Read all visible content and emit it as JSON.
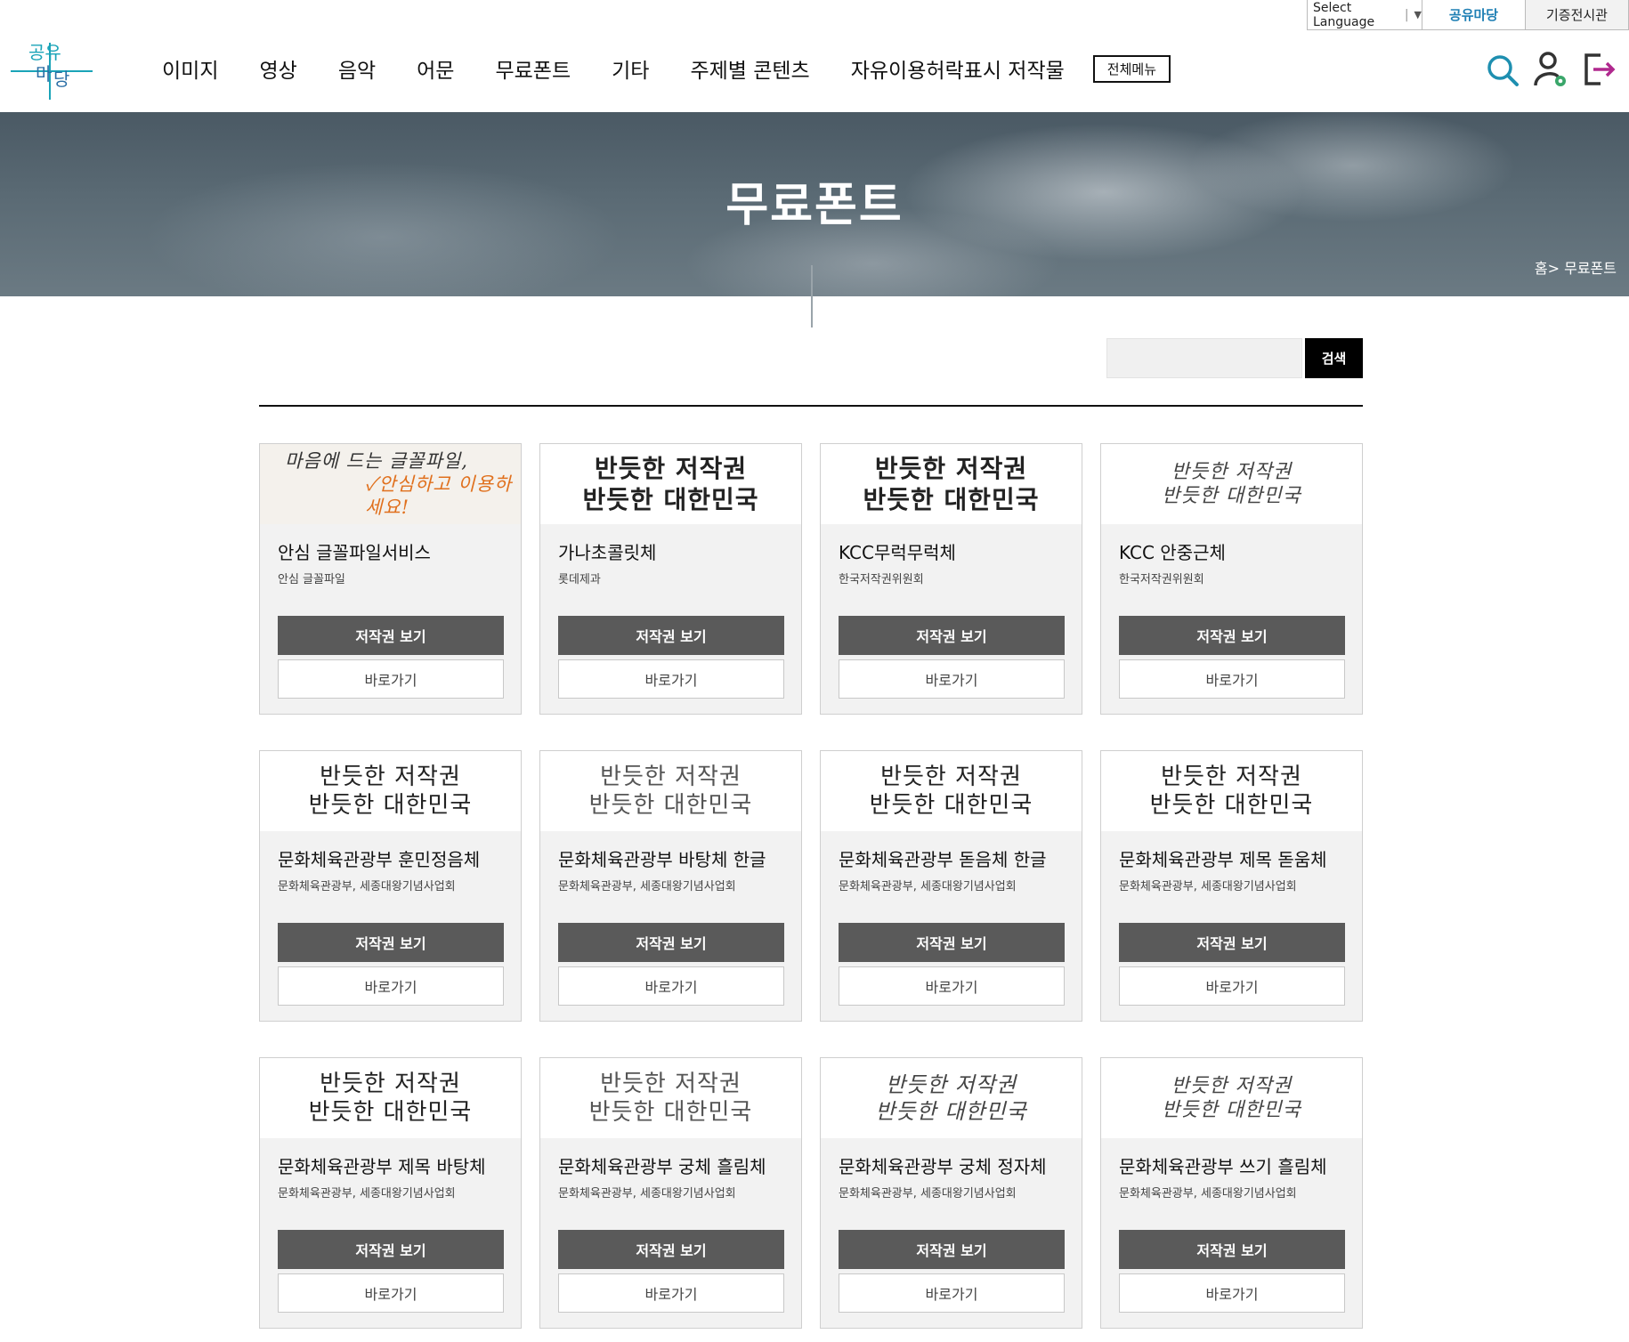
{
  "utility": {
    "language": "Select Language",
    "share_madang": "공유마당",
    "donation_hall": "기증전시관"
  },
  "header": {
    "logo_text": "공유마당",
    "nav": [
      "이미지",
      "영상",
      "음악",
      "어문",
      "무료폰트",
      "기타",
      "주제별 콘텐츠",
      "자유이용허락표시 저작물"
    ],
    "all_menu": "전체메뉴",
    "icons": [
      "search-icon",
      "user-settings-icon",
      "logout-icon"
    ]
  },
  "banner": {
    "title": "무료폰트",
    "breadcrumb": "홈> 무료폰트"
  },
  "search": {
    "placeholder": "",
    "button": "검색"
  },
  "buttons": {
    "copyright": "저작권 보기",
    "go": "바로가기"
  },
  "colors": {
    "accent_blue": "#1e7fb4",
    "button_dark": "#5a5a5a",
    "logo_teal": "#1aa4b8"
  },
  "cards": [
    {
      "preview_lines": [
        "마음에 드는 글꼴파일,",
        "✓안심하고 이용하세요!"
      ],
      "style": "first",
      "title": "안심 글꼴파일서비스",
      "provider": "안심 글꼴파일"
    },
    {
      "preview_lines": [
        "반듯한 저작권",
        "반듯한 대한민국"
      ],
      "style": "bold",
      "title": "가나초콜릿체",
      "provider": "롯데제과"
    },
    {
      "preview_lines": [
        "반듯한 저작권",
        "반듯한 대한민국"
      ],
      "style": "brush",
      "title": "KCC무럭무럭체",
      "provider": "한국저작권위원회"
    },
    {
      "preview_lines": [
        "반듯한 저작권",
        "반듯한 대한민국"
      ],
      "style": "hand",
      "title": "KCC 안중근체",
      "provider": "한국저작권위원회"
    },
    {
      "preview_lines": [
        "반듯한 저작권",
        "반듯한 대한민국"
      ],
      "style": "serif",
      "title": "문화체육관광부 훈민정음체",
      "provider": "문화체육관광부, 세종대왕기념사업회"
    },
    {
      "preview_lines": [
        "반듯한 저작권",
        "반듯한 대한민국"
      ],
      "style": "light",
      "title": "문화체육관광부 바탕체 한글",
      "provider": "문화체육관광부, 세종대왕기념사업회"
    },
    {
      "preview_lines": [
        "반듯한 저작권",
        "반듯한 대한민국"
      ],
      "style": "sans",
      "title": "문화체육관광부 돋음체 한글",
      "provider": "문화체육관광부, 세종대왕기념사업회"
    },
    {
      "preview_lines": [
        "반듯한 저작권",
        "반듯한 대한민국"
      ],
      "style": "sans",
      "title": "문화체육관광부 제목 돋움체",
      "provider": "문화체육관광부, 세종대왕기념사업회"
    },
    {
      "preview_lines": [
        "반듯한 저작권",
        "반듯한 대한민국"
      ],
      "style": "serif",
      "title": "문화체육관광부 제목 바탕체",
      "provider": "문화체육관광부, 세종대왕기념사업회"
    },
    {
      "preview_lines": [
        "반듯한 저작권",
        "반듯한 대한민국"
      ],
      "style": "light",
      "title": "문화체육관광부 궁체 흘림체",
      "provider": "문화체육관광부, 세종대왕기념사업회"
    },
    {
      "preview_lines": [
        "반듯한 저작권",
        "반듯한 대한민국"
      ],
      "style": "script",
      "title": "문화체육관광부 궁체 정자체",
      "provider": "문화체육관광부, 세종대왕기념사업회"
    },
    {
      "preview_lines": [
        "반듯한 저작권",
        "반듯한 대한민국"
      ],
      "style": "hand",
      "title": "문화체육관광부 쓰기 흘림체",
      "provider": "문화체육관광부, 세종대왕기념사업회"
    }
  ]
}
